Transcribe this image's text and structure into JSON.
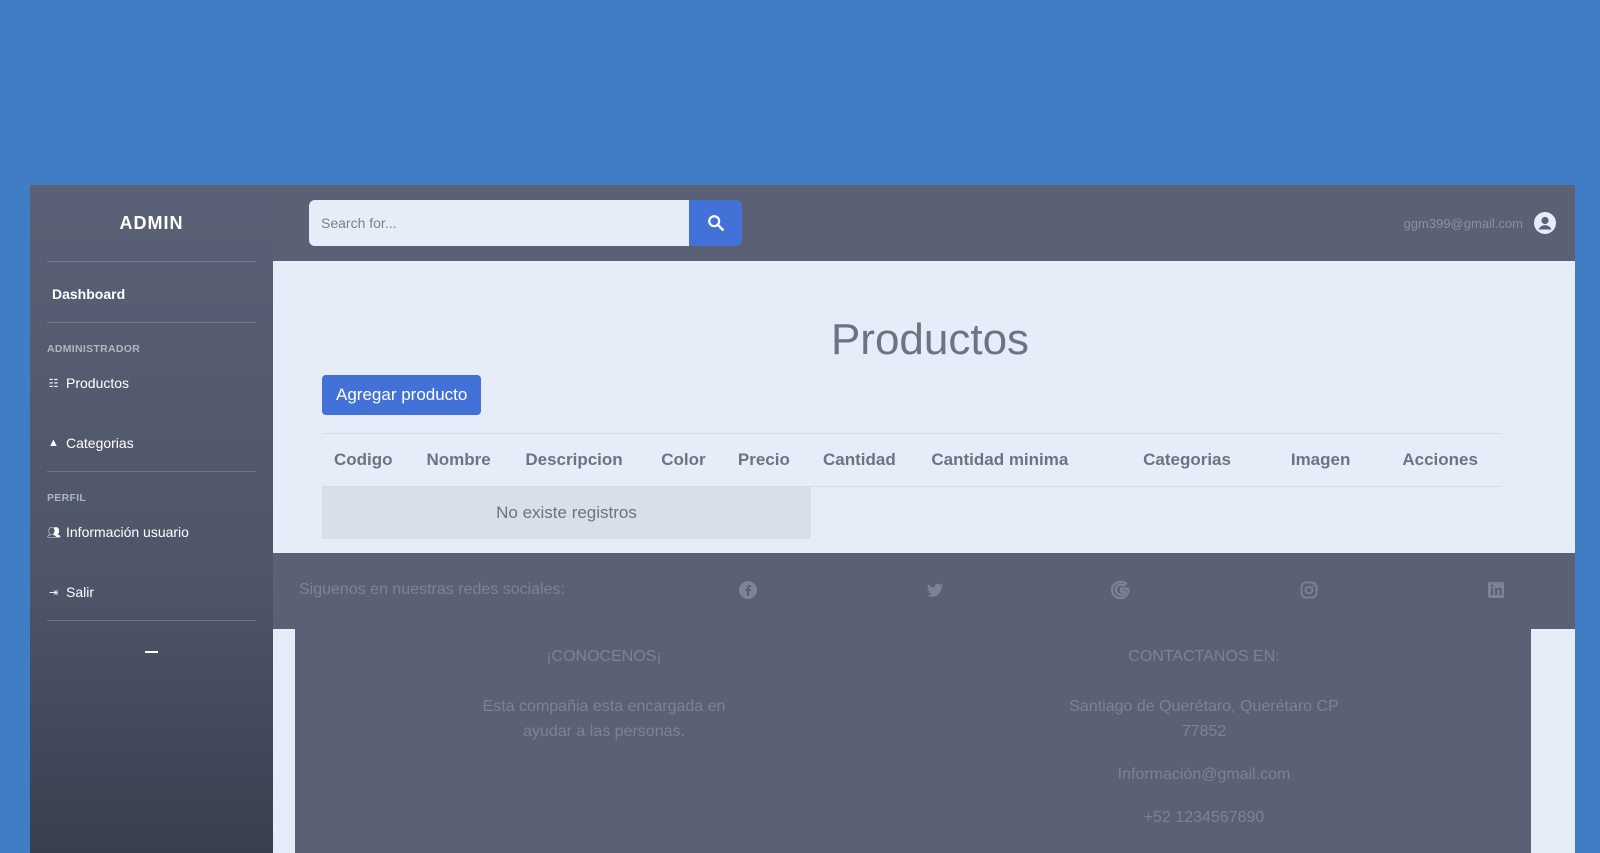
{
  "sidebar": {
    "brand": "ADMIN",
    "dashboard": "Dashboard",
    "sections": [
      {
        "heading": "ADMINISTRADOR",
        "items": [
          {
            "label": "Productos",
            "icon": "list-icon"
          },
          {
            "label": "Categorias",
            "icon": "categories-icon"
          }
        ]
      },
      {
        "heading": "PERFIL",
        "items": [
          {
            "label": "Información usuario",
            "icon": "users-icon"
          },
          {
            "label": "Salir",
            "icon": "logout-icon"
          }
        ]
      }
    ]
  },
  "topbar": {
    "search_placeholder": "Search for...",
    "user_email": "ggm399@gmail.com"
  },
  "main": {
    "title": "Productos",
    "add_button": "Agregar producto",
    "columns": [
      "Codigo",
      "Nombre",
      "Descripcion",
      "Color",
      "Precio",
      "Cantidad",
      "Cantidad minima",
      "Categorias",
      "Imagen",
      "Acciones"
    ],
    "empty_message": "No existe registros"
  },
  "social": {
    "label": "Siguenos en nuestras redes sociales:",
    "icons": [
      "facebook-icon",
      "twitter-icon",
      "google-icon",
      "instagram-icon",
      "linkedin-icon"
    ]
  },
  "footer": {
    "about_title": "¡CONOCENOS¡",
    "about_text": "Esta compañia esta encargada en ayudar a las personas.",
    "contact_title": "CONTACTANOS EN:",
    "address": "Santiago de Querétaro, Querétaro CP 77852",
    "email": "Información@gmail.com",
    "phone": "+52 1234567890"
  },
  "colors": {
    "background": "#407dc4",
    "sidebar": "#5a6176",
    "topbar": "#5a6175",
    "accent": "#4272d7",
    "content": "#e7edf8"
  }
}
